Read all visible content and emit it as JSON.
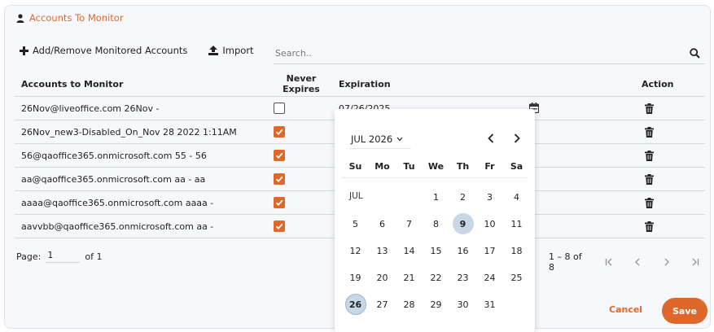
{
  "header": {
    "title": "Accounts To Monitor"
  },
  "toolbar": {
    "add_remove_label": "Add/Remove Monitored Accounts",
    "import_label": "Import"
  },
  "search": {
    "placeholder": "Search.."
  },
  "grid": {
    "columns": {
      "accounts": "Accounts to Monitor",
      "never_line1": "Never",
      "never_line2": "Expires",
      "expiration": "Expiration",
      "action": "Action"
    },
    "rows": [
      {
        "account": "26Nov@liveoffice.com 26Nov -",
        "never_expires": false,
        "expiration": "07/26/2025"
      },
      {
        "account": "26Nov_new3-Disabled_On_Nov 28 2022 1:11AM",
        "never_expires": true,
        "expiration": ""
      },
      {
        "account": "56@qaoffice365.onmicrosoft.com 55 - 56",
        "never_expires": true,
        "expiration": ""
      },
      {
        "account": "aa@qaoffice365.onmicrosoft.com aa - aa",
        "never_expires": true,
        "expiration": ""
      },
      {
        "account": "aaaa@qaoffice365.onmicrosoft.com aaaa -",
        "never_expires": true,
        "expiration": ""
      },
      {
        "account": "aavvbb@qaoffice365.onmicrosoft.com aa -",
        "never_expires": true,
        "expiration": ""
      }
    ]
  },
  "pager": {
    "page_label": "Page:",
    "page_value": "1",
    "of_label": "of 1",
    "range": "1 – 8 of 8"
  },
  "buttons": {
    "cancel": "Cancel",
    "save": "Save"
  },
  "calendar": {
    "month_label": "JUL 2026",
    "weekdays": [
      "Su",
      "Mo",
      "Tu",
      "We",
      "Th",
      "Fr",
      "Sa"
    ],
    "section_label": "JUL",
    "weeks": [
      [
        "",
        "",
        "",
        "1",
        "2",
        "3",
        "4"
      ],
      [
        "5",
        "6",
        "7",
        "8",
        "9",
        "10",
        "11"
      ],
      [
        "12",
        "13",
        "14",
        "15",
        "16",
        "17",
        "18"
      ],
      [
        "19",
        "20",
        "21",
        "22",
        "23",
        "24",
        "25"
      ],
      [
        "26",
        "27",
        "28",
        "29",
        "30",
        "31",
        ""
      ]
    ],
    "today": "9",
    "selected": "26"
  },
  "colors": {
    "accent": "#e0672a",
    "highlight": "#c8d7e6"
  }
}
